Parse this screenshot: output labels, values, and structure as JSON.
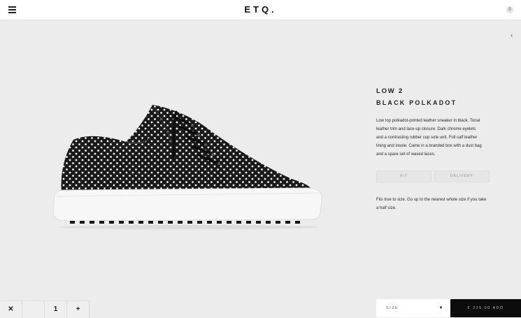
{
  "header": {
    "logo": "ETQ.",
    "cart_count": "0"
  },
  "nav": {
    "side_arrow": "‹"
  },
  "product": {
    "name": "LOW 2",
    "colorway": "BLACK POLKADOT",
    "description": "Low top polkadot-printed leather sneaker in black. Tonal leather trim and lace-up closure. Dark chrome eyelets and a contrasting rubber cup sole unit. Full calf leather lining and insole. Came in a branded box with a dust bag and a spare set of waxed laces.",
    "tabs": [
      "FIT",
      "DELIVERY"
    ],
    "fit_note": "Fits true to size. Go up to the nearest whole size if you take a half size.",
    "colors": {
      "upper": "#1a1a1a",
      "dots": "#f4f4f4",
      "sole": "#f7f7f7",
      "background": "#ececec"
    }
  },
  "bottom_bar": {
    "qty_buttons": [
      "✕",
      "1",
      "+"
    ],
    "size_label": "SIZE",
    "add_label": "€ 225,00 ADD"
  }
}
